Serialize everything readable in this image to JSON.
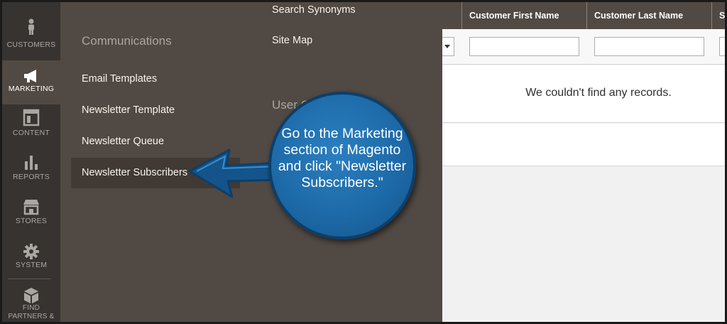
{
  "nav": {
    "items": [
      {
        "label": "CUSTOMERS",
        "icon": "person-icon"
      },
      {
        "label": "MARKETING",
        "icon": "megaphone-icon"
      },
      {
        "label": "CONTENT",
        "icon": "layout-icon"
      },
      {
        "label": "REPORTS",
        "icon": "bar-chart-icon"
      },
      {
        "label": "STORES",
        "icon": "storefront-icon"
      },
      {
        "label": "SYSTEM",
        "icon": "gear-icon"
      },
      {
        "label": "FIND PARTNERS & EXTENSIONS",
        "icon": "blocks-icon"
      }
    ]
  },
  "flyout": {
    "section_heading": "Communications",
    "links": [
      "Email Templates",
      "Newsletter Template",
      "Newsletter Queue",
      "Newsletter Subscribers"
    ],
    "col2_links": [
      "Search Synonyms",
      "Site Map"
    ],
    "col2_heading": "User Content"
  },
  "grid": {
    "columns": [
      "Customer First Name",
      "Customer Last Name",
      "St"
    ],
    "first_name_filter": "",
    "last_name_filter": "",
    "empty_message": "We couldn't find any records."
  },
  "callout": {
    "text": "Go to the Marketing section of Magento and click \"Newsletter Subscribers.\""
  },
  "colors": {
    "nav_bg": "#373330",
    "flyout_bg": "#514943",
    "callout_blue": "#1d6aa8"
  }
}
